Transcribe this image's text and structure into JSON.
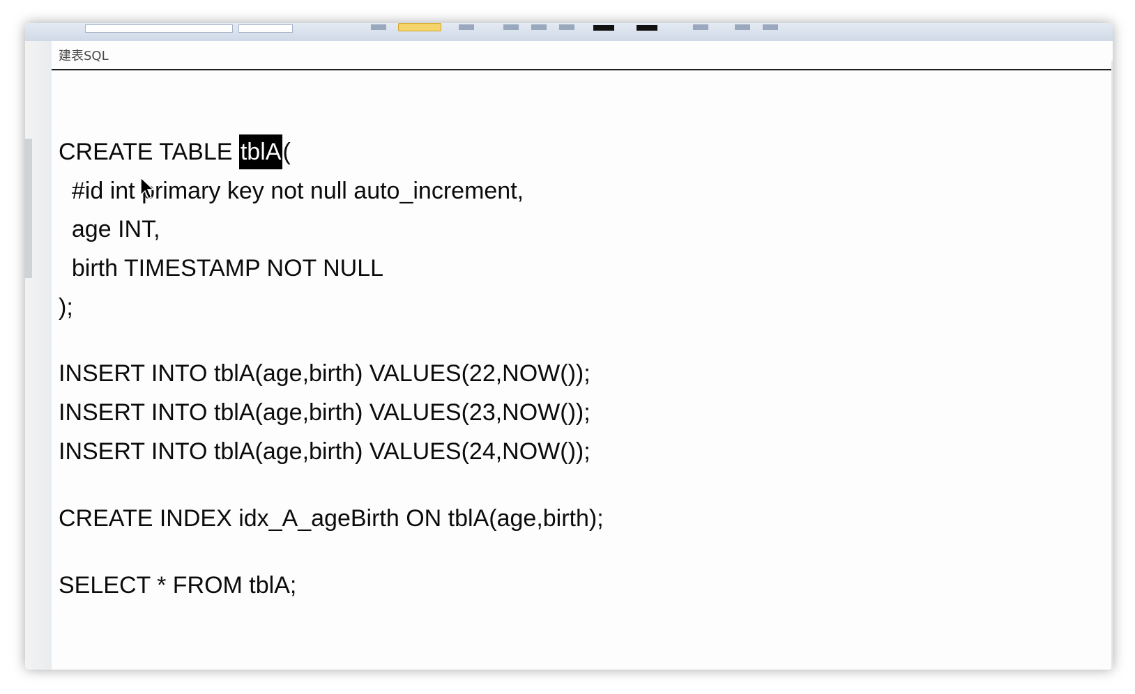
{
  "tab": {
    "title": "建表SQL"
  },
  "editor": {
    "lines": [
      {
        "text": "CREATE TABLE ",
        "selected": "tblA",
        "after": "("
      },
      {
        "text": "  #id int primary key not null auto_increment,"
      },
      {
        "text": "  age INT,"
      },
      {
        "text": "  birth TIMESTAMP NOT NULL"
      },
      {
        "text": ");"
      },
      {
        "text": "INSERT INTO tblA(age,birth) VALUES(22,NOW());"
      },
      {
        "text": "INSERT INTO tblA(age,birth) VALUES(23,NOW());"
      },
      {
        "text": "INSERT INTO tblA(age,birth) VALUES(24,NOW());"
      },
      {
        "text": "CREATE INDEX idx_A_ageBirth ON tblA(age,birth);"
      },
      {
        "text": "SELECT * FROM tblA;"
      }
    ],
    "selection_color": "#000000",
    "text_color": "#0b0b0b"
  },
  "icons": [
    "mouse-pointer-icon"
  ]
}
